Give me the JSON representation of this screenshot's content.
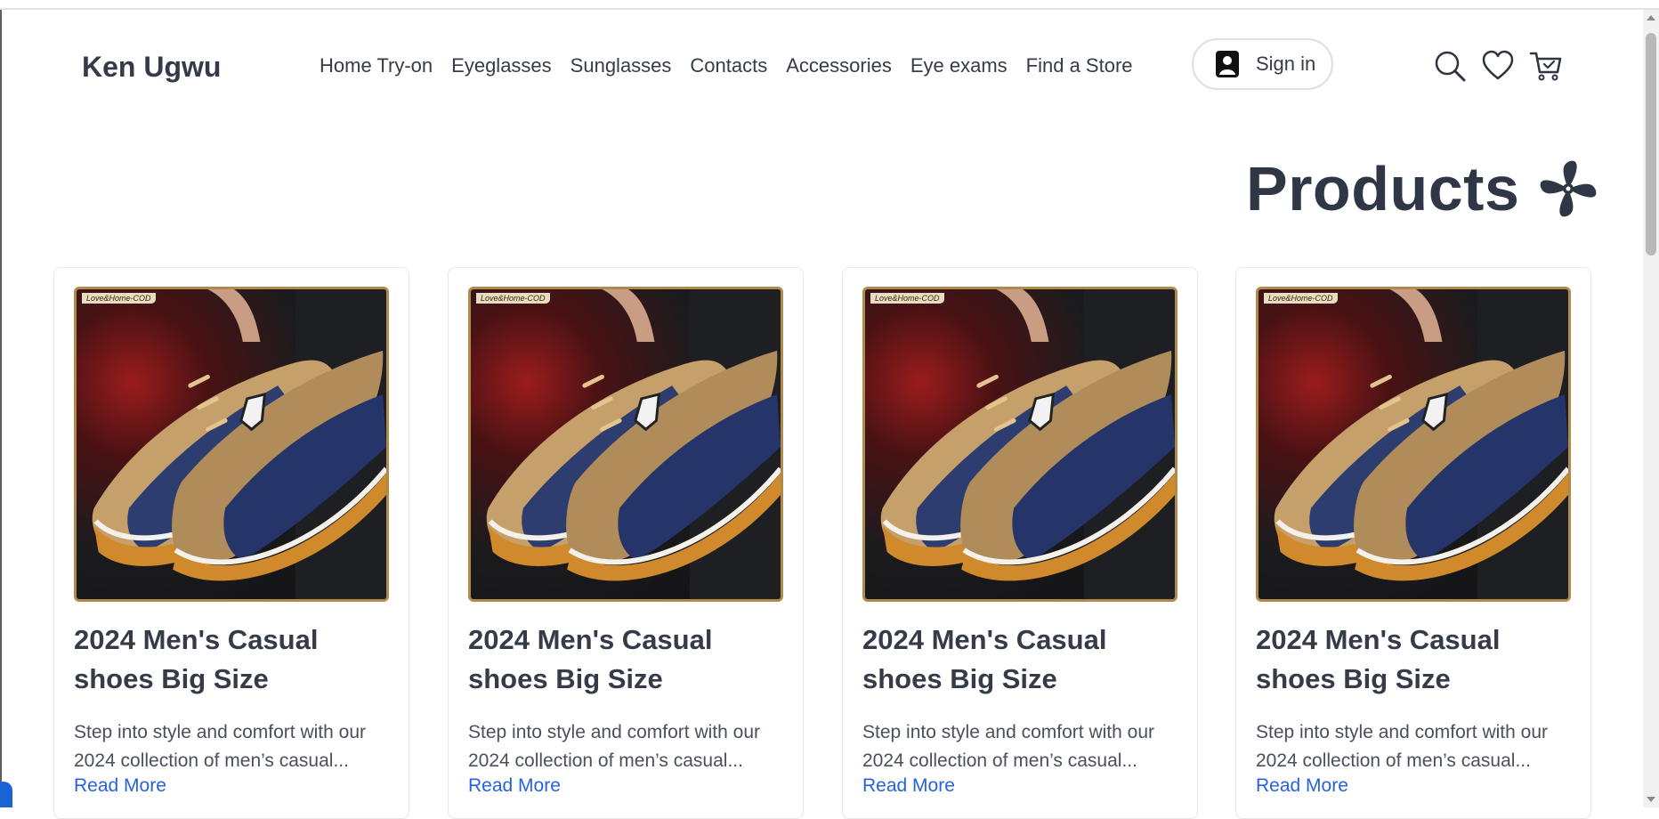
{
  "header": {
    "brand": "Ken Ugwu",
    "nav": [
      "Home Try-on",
      "Eyeglasses",
      "Sunglasses",
      "Contacts",
      "Accessories",
      "Eye exams",
      "Find a Store"
    ],
    "signin_label": "Sign in",
    "icons": [
      "search-icon",
      "heart-icon",
      "cart-icon"
    ]
  },
  "main": {
    "title": "Products",
    "title_icon": "fan-icon"
  },
  "products": [
    {
      "tag": "Love&Home-COD",
      "title": "2024 Men's Casual shoes Big Size",
      "description": "Step into style and comfort with our 2024 collection of men’s casual...",
      "link": "Read More"
    },
    {
      "tag": "Love&Home-COD",
      "title": "2024 Men's Casual shoes Big Size",
      "description": "Step into style and comfort with our 2024 collection of men’s casual...",
      "link": "Read More"
    },
    {
      "tag": "Love&Home-COD",
      "title": "2024 Men's Casual shoes Big Size",
      "description": "Step into style and comfort with our 2024 collection of men’s casual...",
      "link": "Read More"
    },
    {
      "tag": "Love&Home-COD",
      "title": "2024 Men's Casual shoes Big Size",
      "description": "Step into style and comfort with our 2024 collection of men’s casual...",
      "link": "Read More"
    }
  ],
  "colors": {
    "link": "#2563d9",
    "text": "#353b47",
    "card_border": "#e5e7ea",
    "image_frame": "#b08a4a"
  }
}
